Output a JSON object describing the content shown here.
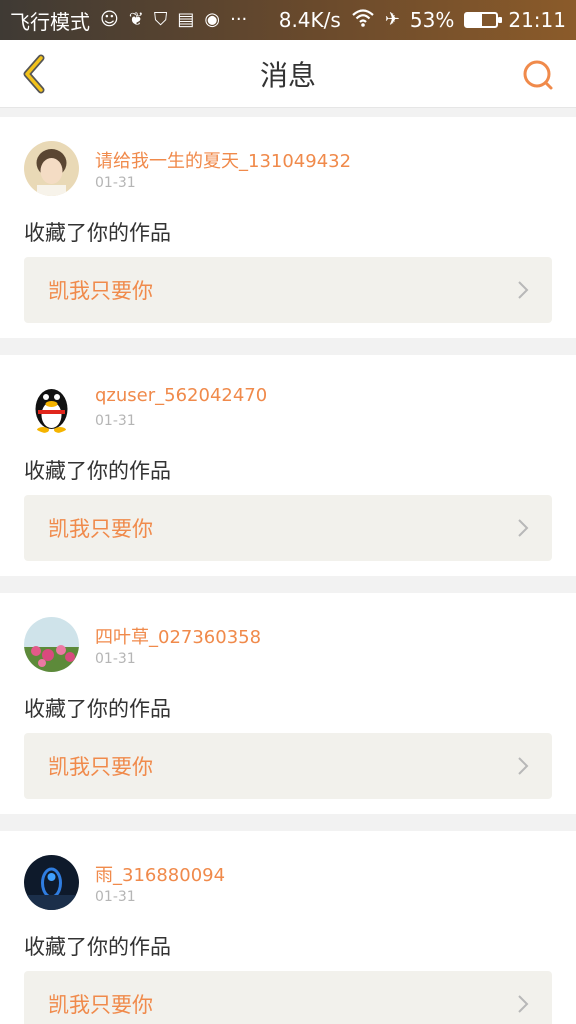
{
  "status_bar": {
    "mode": "飞行模式",
    "speed": "8.4K/s",
    "battery": "53%",
    "battery_level": 0.53,
    "time": "21:11",
    "icons": [
      "emoji-icon",
      "leaf-icon",
      "shield-icon",
      "storage-icon",
      "camera-icon",
      "more-icon",
      "wifi-icon",
      "airplane-icon",
      "battery-icon"
    ]
  },
  "header": {
    "title": "消息"
  },
  "colors": {
    "accent": "#f08a4b",
    "back_icon": "#f2c21b",
    "work_bg": "#f2f1ec"
  },
  "messages": [
    {
      "username": "请给我一生的夏天_131049432",
      "date": "01-31",
      "action": "收藏了你的作品",
      "work_title": "凯我只要你",
      "avatar_icon": "photo-avatar-icon"
    },
    {
      "username": "qzuser_562042470",
      "date": "01-31",
      "action": "收藏了你的作品",
      "work_title": "凯我只要你",
      "avatar_icon": "penguin-avatar-icon"
    },
    {
      "username": "四叶草_027360358",
      "date": "01-31",
      "action": "收藏了你的作品",
      "work_title": "凯我只要你",
      "avatar_icon": "flower-avatar-icon"
    },
    {
      "username": "雨_316880094",
      "date": "01-31",
      "action": "收藏了你的作品",
      "work_title": "凯我只要你",
      "avatar_icon": "night-avatar-icon"
    }
  ]
}
